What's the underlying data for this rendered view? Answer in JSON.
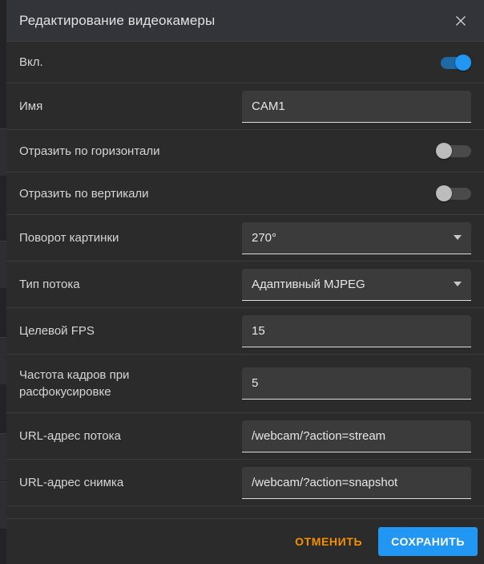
{
  "dialog": {
    "title": "Редактирование видеокамеры",
    "close_icon": "close-icon"
  },
  "rows": [
    {
      "label": "Вкл.",
      "type": "toggle",
      "value": "on"
    },
    {
      "label": "Имя",
      "type": "text",
      "value": "CAM1"
    },
    {
      "label": "Отразить по горизонтали",
      "type": "toggle",
      "value": "off"
    },
    {
      "label": "Отразить по вертикали",
      "type": "toggle",
      "value": "off"
    },
    {
      "label": "Поворот картинки",
      "type": "select",
      "value": "270°"
    },
    {
      "label": "Тип потока",
      "type": "select",
      "value": "Адаптивный MJPEG"
    },
    {
      "label": "Целевой FPS",
      "type": "text",
      "value": "15"
    },
    {
      "label": "Частота кадров при",
      "label_line2": "расфокусировке",
      "type": "text",
      "value": "5"
    },
    {
      "label": "URL-адрес потока",
      "type": "text",
      "value": "/webcam/?action=stream"
    },
    {
      "label": "URL-адрес снимка",
      "type": "text",
      "value": "/webcam/?action=snapshot"
    }
  ],
  "footer": {
    "cancel_label": "ОТМЕНИТЬ",
    "save_label": "СОХРАНИТЬ"
  },
  "colors": {
    "accent_blue": "#2196f3",
    "accent_orange": "#f59000",
    "dialog_bg": "#2b2b2b",
    "titlebar_bg": "#33333a",
    "field_bg": "#3b3b3b"
  }
}
